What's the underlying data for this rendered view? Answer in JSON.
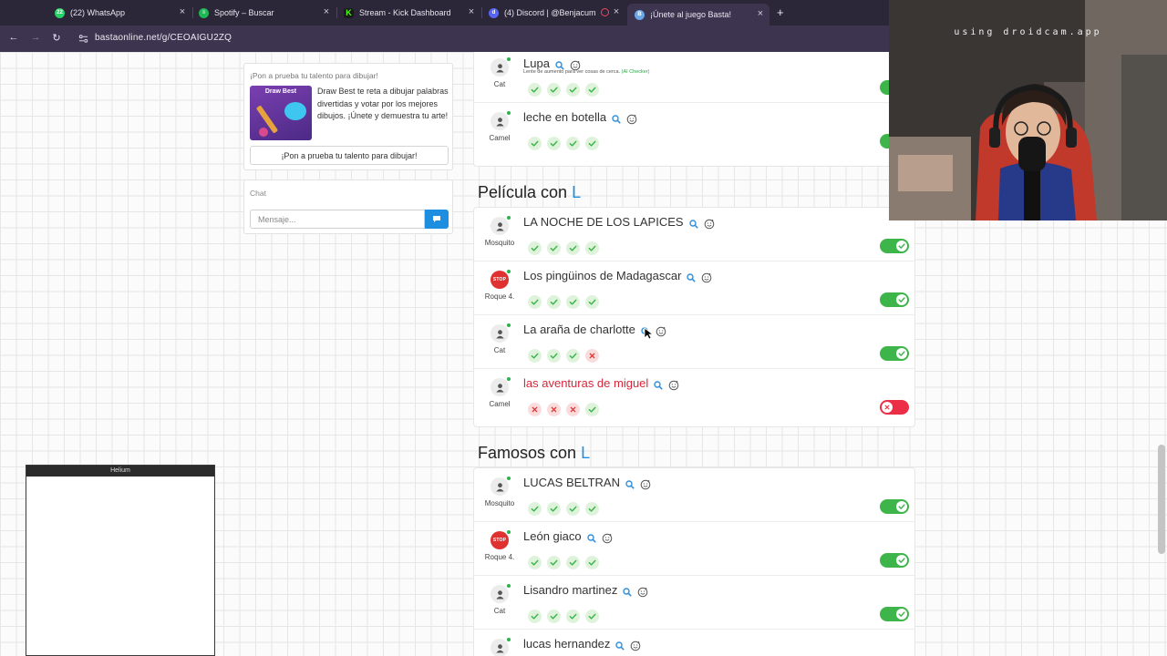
{
  "browser": {
    "tabs": [
      {
        "label": "(22) WhatsApp",
        "icon": "whatsapp-icon",
        "badge": "22",
        "color": "#25d366"
      },
      {
        "label": "Spotify – Buscar",
        "icon": "spotify-icon",
        "color": "#1db954"
      },
      {
        "label": "Stream - Kick Dashboard",
        "icon": "kick-icon",
        "color": "#53fc18"
      },
      {
        "label": "(4) Discord | @Benjacum",
        "icon": "discord-icon",
        "color": "#5865f2"
      },
      {
        "label": "¡Únete al juego Basta!",
        "icon": "basta-icon",
        "color": "#6aa8e8"
      }
    ],
    "url": "bastaonline.net/g/CEOAIGU2ZQ"
  },
  "sidebar": {
    "promo_heading": "¡Pon a prueba tu talento para dibujar!",
    "promo_thumb_title": "Draw Best",
    "promo_text": "Draw Best te reta a dibujar palabras divertidas y votar por los mejores dibujos. ¡Únete y demuestra tu arte!",
    "promo_button": "¡Pon a prueba tu talento para dibujar!",
    "chat_title": "Chat",
    "chat_placeholder": "Mensaje..."
  },
  "top_rows": [
    {
      "player": "Cat",
      "answer": "Lupa",
      "hint": "Lente de aumento para ver cosas de cerca.",
      "hint_tag": "(AI Checker)",
      "votes": [
        "ok",
        "ok",
        "ok",
        "ok"
      ],
      "valid": true,
      "stop": false
    },
    {
      "player": "Camel",
      "answer": "leche en botella",
      "votes": [
        "ok",
        "ok",
        "ok",
        "ok"
      ],
      "valid": true,
      "stop": false
    }
  ],
  "sections": [
    {
      "title_prefix": "Película con",
      "letter": "L",
      "rows": [
        {
          "player": "Mosquito",
          "answer": "LA NOCHE DE LOS LAPICES",
          "votes": [
            "ok",
            "ok",
            "ok",
            "ok"
          ],
          "valid": true,
          "stop": false
        },
        {
          "player": "Roque 4.",
          "answer": "Los pingüinos de Madagascar",
          "votes": [
            "ok",
            "ok",
            "ok",
            "ok"
          ],
          "valid": true,
          "stop": true
        },
        {
          "player": "Cat",
          "answer": "La araña de charlotte",
          "votes": [
            "ok",
            "ok",
            "ok",
            "no"
          ],
          "valid": true,
          "stop": false
        },
        {
          "player": "Camel",
          "answer": "las aventuras de miguel",
          "votes": [
            "no",
            "no",
            "no",
            "ok"
          ],
          "valid": false,
          "stop": false
        }
      ]
    },
    {
      "title_prefix": "Famosos con",
      "letter": "L",
      "rows": [
        {
          "player": "Mosquito",
          "answer": "LUCAS BELTRAN",
          "votes": [
            "ok",
            "ok",
            "ok",
            "ok"
          ],
          "valid": true,
          "stop": false
        },
        {
          "player": "Roque 4.",
          "answer": "León giaco",
          "votes": [
            "ok",
            "ok",
            "ok",
            "ok"
          ],
          "valid": true,
          "stop": true
        },
        {
          "player": "Cat",
          "answer": "Lisandro martinez",
          "votes": [
            "ok",
            "ok",
            "ok",
            "ok"
          ],
          "valid": true,
          "stop": false
        },
        {
          "player": "",
          "answer": "lucas hernandez",
          "votes": [],
          "valid": true,
          "stop": false
        }
      ]
    }
  ],
  "stop_badge": "STOP",
  "webcam": {
    "label": "using droidcam.app"
  },
  "helium": {
    "title": "Helium"
  },
  "colors": {
    "accent": "#1e8fe0",
    "ok": "#3db54a",
    "error": "#ec2f47",
    "tabbar": "#2b2638"
  }
}
